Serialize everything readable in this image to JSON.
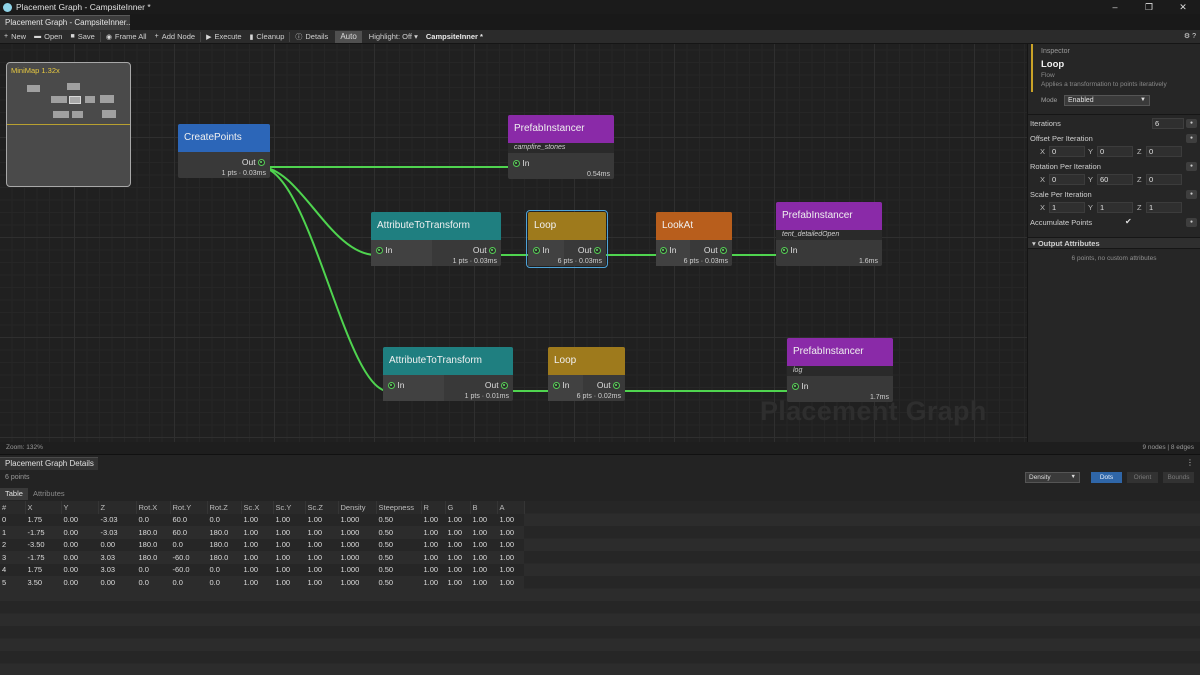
{
  "window": {
    "title": "Placement Graph - CampsiteInner *",
    "controls": [
      "–",
      "❐",
      "✕"
    ]
  },
  "doc_tab": {
    "label": "Placement Graph - CampsiteInner..."
  },
  "toolbar": {
    "new": "New",
    "open": "Open",
    "save": "Save",
    "frame_all": "Frame All",
    "add_node": "Add Node",
    "execute": "Execute",
    "cleanup": "Cleanup",
    "details": "Details",
    "auto": "Auto",
    "highlight": "Highlight: Off ▾",
    "graph_name": "CampsiteInner *",
    "help": "⚙ ?"
  },
  "minimap": {
    "label": "MiniMap  1.32x"
  },
  "graph": {
    "watermark": "Placement Graph",
    "zoom": "Zoom: 132%",
    "counts": "9 nodes  |  8 edges",
    "wire_color": "#4fd44f",
    "nodes": [
      {
        "title": "CreatePoints",
        "color": "#2c66b8",
        "out": "Out",
        "stat": "1 pts · 0.03ms"
      },
      {
        "title": "PrefabInstancer",
        "color": "#8a2aa8",
        "subtitle": "campfire_stones",
        "in": "In",
        "stat": "0.54ms"
      },
      {
        "title": "AttributeToTransform",
        "color": "#1f7f80",
        "in": "In",
        "out": "Out",
        "stat": "1 pts · 0.03ms"
      },
      {
        "title": "Loop",
        "color": "#9e7a1c",
        "in": "In",
        "out": "Out",
        "stat": "6 pts · 0.03ms"
      },
      {
        "title": "LookAt",
        "color": "#b85e1c",
        "in": "In",
        "out": "Out",
        "stat": "6 pts · 0.03ms"
      },
      {
        "title": "PrefabInstancer",
        "color": "#8a2aa8",
        "subtitle": "tent_detailedOpen",
        "in": "In",
        "stat": "1.6ms"
      },
      {
        "title": "AttributeToTransform",
        "color": "#1f7f80",
        "in": "In",
        "out": "Out",
        "stat": "1 pts · 0.01ms"
      },
      {
        "title": "Loop",
        "color": "#9e7a1c",
        "in": "In",
        "out": "Out",
        "stat": "6 pts · 0.02ms"
      },
      {
        "title": "PrefabInstancer",
        "color": "#8a2aa8",
        "subtitle": "log",
        "in": "In",
        "stat": "1.7ms"
      }
    ]
  },
  "inspector": {
    "kicker": "Inspector",
    "name": "Loop",
    "category": "Flow",
    "description": "Applies a transformation to points iteratively",
    "accent": "#c9a227",
    "mode_label": "Mode",
    "mode_value": "Enabled",
    "iterations_label": "Iterations",
    "iterations_value": "6",
    "offset_label": "Offset Per Iteration",
    "offset": {
      "x": "0",
      "y": "0",
      "z": "0"
    },
    "rotation_label": "Rotation Per Iteration",
    "rotation": {
      "x": "0",
      "y": "60",
      "z": "0"
    },
    "scale_label": "Scale Per Iteration",
    "scale": {
      "x": "1",
      "y": "1",
      "z": "1"
    },
    "accumulate_label": "Accumulate Points",
    "accumulate_check": "✔",
    "output_header": "▾ Output Attributes",
    "output_note": "6 points, no custom attributes",
    "axis_x": "X",
    "axis_y": "Y",
    "axis_z": "Z",
    "btn_glyph": "●"
  },
  "details": {
    "tab": "Placement Graph Details",
    "menu": "⋮",
    "points": "6 points",
    "color_by": "Density",
    "toggles": [
      "Dots",
      "Orient",
      "Bounds"
    ],
    "accent": "#2f66a8",
    "subtabs": [
      "Table",
      "Attributes"
    ],
    "columns": [
      "#",
      "X",
      "Y",
      "Z",
      "Rot.X",
      "Rot.Y",
      "Rot.Z",
      "Sc.X",
      "Sc.Y",
      "Sc.Z",
      "Density",
      "Steepness",
      "R",
      "G",
      "B",
      "A"
    ],
    "rows": [
      [
        "0",
        "1.75",
        "0.00",
        "-3.03",
        "0.0",
        "60.0",
        "0.0",
        "1.00",
        "1.00",
        "1.00",
        "1.000",
        "0.50",
        "1.00",
        "1.00",
        "1.00",
        "1.00"
      ],
      [
        "1",
        "-1.75",
        "0.00",
        "-3.03",
        "180.0",
        "60.0",
        "180.0",
        "1.00",
        "1.00",
        "1.00",
        "1.000",
        "0.50",
        "1.00",
        "1.00",
        "1.00",
        "1.00"
      ],
      [
        "2",
        "-3.50",
        "0.00",
        "0.00",
        "180.0",
        "0.0",
        "180.0",
        "1.00",
        "1.00",
        "1.00",
        "1.000",
        "0.50",
        "1.00",
        "1.00",
        "1.00",
        "1.00"
      ],
      [
        "3",
        "-1.75",
        "0.00",
        "3.03",
        "180.0",
        "-60.0",
        "180.0",
        "1.00",
        "1.00",
        "1.00",
        "1.000",
        "0.50",
        "1.00",
        "1.00",
        "1.00",
        "1.00"
      ],
      [
        "4",
        "1.75",
        "0.00",
        "3.03",
        "0.0",
        "-60.0",
        "0.0",
        "1.00",
        "1.00",
        "1.00",
        "1.000",
        "0.50",
        "1.00",
        "1.00",
        "1.00",
        "1.00"
      ],
      [
        "5",
        "3.50",
        "0.00",
        "0.00",
        "0.0",
        "0.0",
        "0.0",
        "1.00",
        "1.00",
        "1.00",
        "1.000",
        "0.50",
        "1.00",
        "1.00",
        "1.00",
        "1.00"
      ]
    ]
  }
}
